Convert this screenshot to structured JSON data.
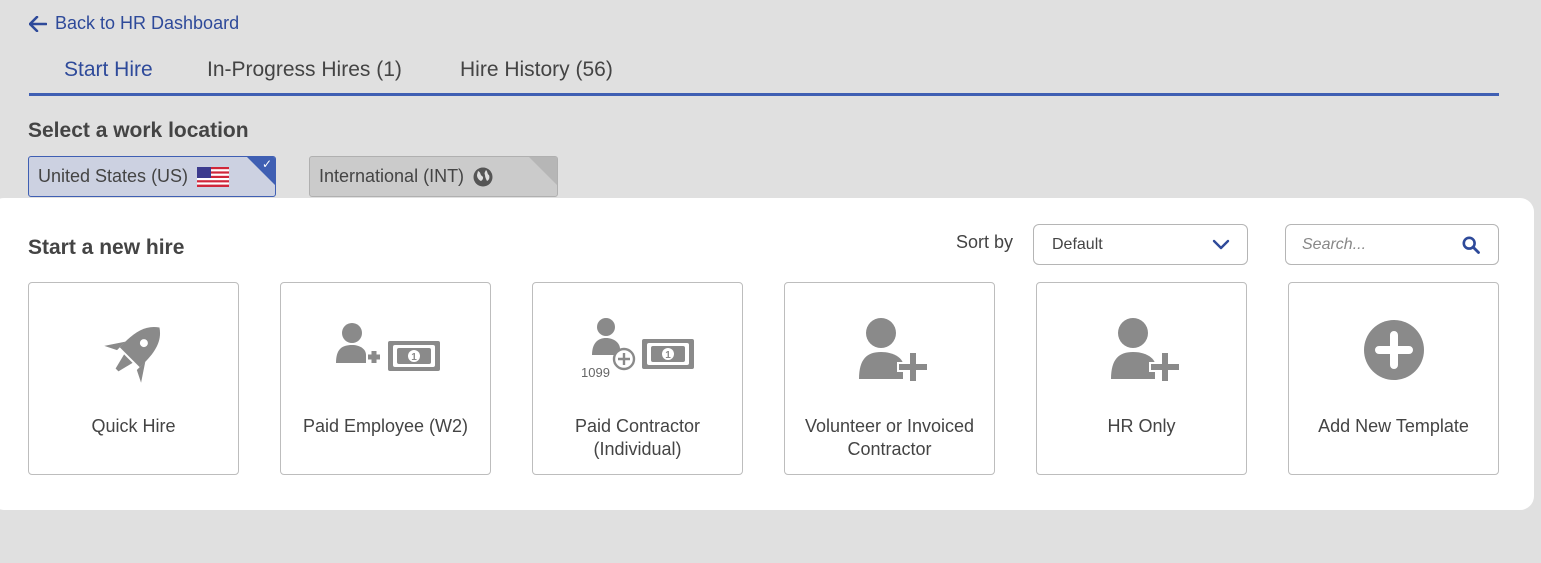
{
  "nav": {
    "back_label": "Back to HR Dashboard"
  },
  "tabs": [
    {
      "label": "Start Hire",
      "active": true
    },
    {
      "label": "In-Progress Hires (1)",
      "active": false
    },
    {
      "label": "Hire History (56)",
      "active": false
    }
  ],
  "location": {
    "title": "Select a work location",
    "options": [
      {
        "label": "United States (US)",
        "icon": "us-flag-icon",
        "selected": true
      },
      {
        "label": "International (INT)",
        "icon": "globe-icon",
        "selected": false
      }
    ]
  },
  "new_hire": {
    "title": "Start a new hire",
    "sort_label": "Sort by",
    "sort_value": "Default",
    "search_placeholder": "Search...",
    "cards": [
      {
        "label": "Quick Hire",
        "icon": "rocket-icon"
      },
      {
        "label": "Paid Employee (W2)",
        "icon": "add-user-money-icon"
      },
      {
        "label": "Paid Contractor (Individual)",
        "icon": "add-user-1099-money-icon",
        "badge": "1099"
      },
      {
        "label": "Volunteer or Invoiced Contractor",
        "icon": "add-user-icon"
      },
      {
        "label": "HR Only",
        "icon": "add-user-icon"
      },
      {
        "label": "Add New Template",
        "icon": "plus-circle-icon"
      }
    ]
  },
  "colors": {
    "accent": "#3f5fb3",
    "link": "#2e4a9a",
    "icon_grey": "#8a8a8a",
    "background": "#e0e0e0"
  }
}
